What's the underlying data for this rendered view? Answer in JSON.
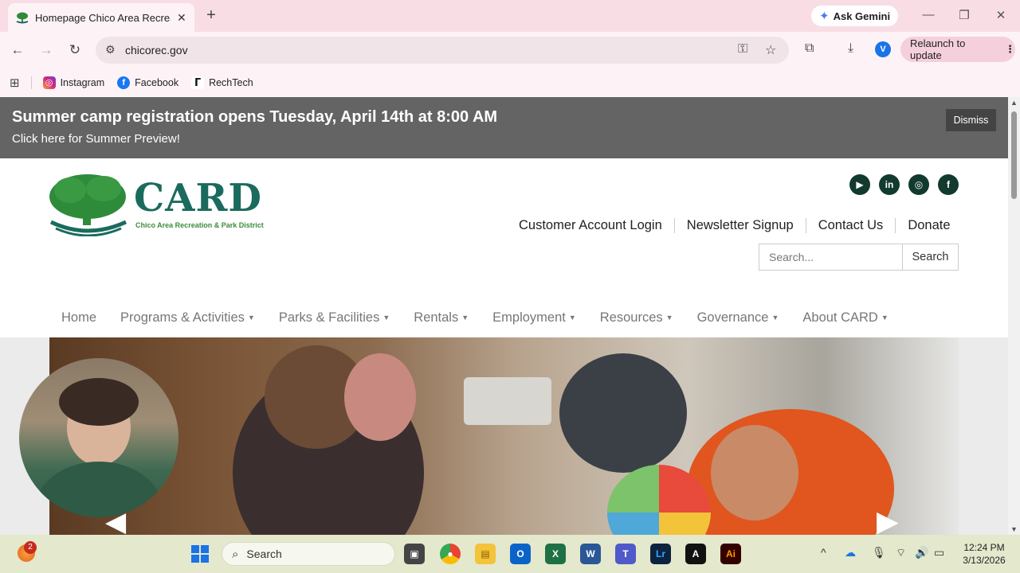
{
  "browser": {
    "tab_title": "Homepage Chico Area Recreati",
    "tab_close": "✕",
    "new_tab": "+",
    "ask_gemini": "Ask Gemini",
    "url": "chicorec.gov",
    "avatar_letter": "V",
    "relaunch": "Relaunch to update"
  },
  "bookmarks": [
    {
      "label": "Instagram",
      "icon": "instagram-icon"
    },
    {
      "label": "Facebook",
      "icon": "facebook-icon"
    },
    {
      "label": "RechTech",
      "icon": "rechtech-icon"
    }
  ],
  "banner": {
    "headline": "Summer camp registration opens Tuesday, April 14th at 8:00 AM",
    "link": "Click here for Summer Preview!",
    "dismiss": "Dismiss"
  },
  "logo": {
    "brand": "CARD",
    "subtitle": "Chico Area Recreation & Park District"
  },
  "social": [
    "youtube-icon",
    "linkedin-icon",
    "instagram-icon",
    "facebook-icon"
  ],
  "top_links": [
    "Customer Account Login",
    "Newsletter Signup",
    "Contact Us",
    "Donate"
  ],
  "search": {
    "placeholder": "Search...",
    "button": "Search"
  },
  "nav": [
    {
      "label": "Home",
      "dropdown": false
    },
    {
      "label": "Programs & Activities",
      "dropdown": true
    },
    {
      "label": "Parks & Facilities",
      "dropdown": true
    },
    {
      "label": "Rentals",
      "dropdown": true
    },
    {
      "label": "Employment",
      "dropdown": true
    },
    {
      "label": "Resources",
      "dropdown": true
    },
    {
      "label": "Governance",
      "dropdown": true
    },
    {
      "label": "About CARD",
      "dropdown": true
    }
  ],
  "taskbar": {
    "search_label": "Search",
    "notification_count": "2",
    "time": "12:24 PM",
    "date": "3/13/2026"
  },
  "colors": {
    "banner_bg": "#646464",
    "brand_teal": "#1a6b5d",
    "brand_green": "#3b8c3c",
    "social_bg": "#123a2e",
    "tab_strip": "#f9dde5"
  }
}
